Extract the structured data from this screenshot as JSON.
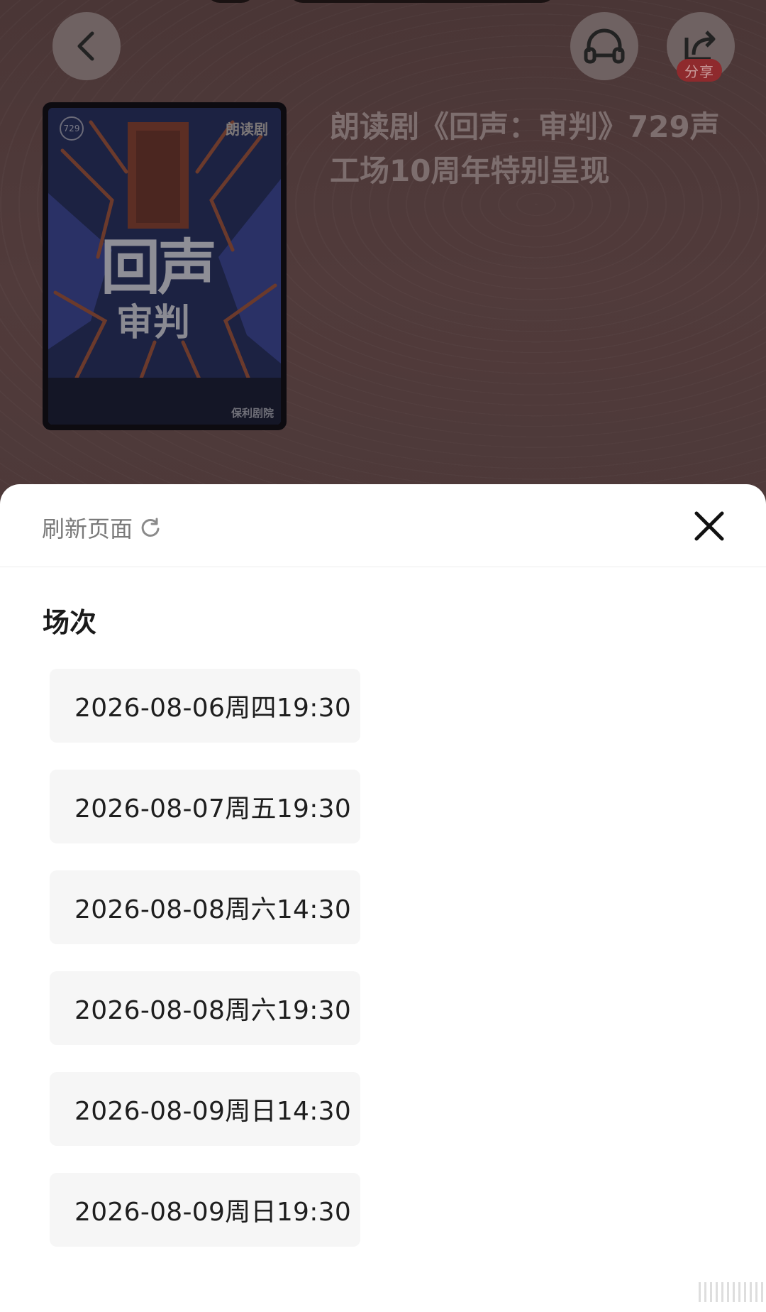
{
  "header": {
    "share_label": "分享"
  },
  "event": {
    "poster": {
      "tag": "朗读剧",
      "logo_text": "729",
      "title_line1": "回声",
      "title_line2": "审判",
      "footer_text": "保利剧院"
    },
    "title": "朗读剧《回声：审判》729声工场10周年特别呈现"
  },
  "sheet": {
    "refresh_label": "刷新页面",
    "section_title": "场次",
    "sessions": [
      "2026-08-06周四19:30",
      "2026-08-07周五19:30",
      "2026-08-08周六14:30",
      "2026-08-08周六19:30",
      "2026-08-09周日14:30",
      "2026-08-09周日19:30"
    ]
  },
  "colors": {
    "overlay_bg": "#4d3939",
    "badge": "#8f2a2d",
    "session_bg": "#f6f6f6"
  },
  "icons": {
    "back": "chevron-left-icon",
    "listen": "headphones-icon",
    "share": "share-icon",
    "refresh": "refresh-icon",
    "close": "close-icon"
  }
}
